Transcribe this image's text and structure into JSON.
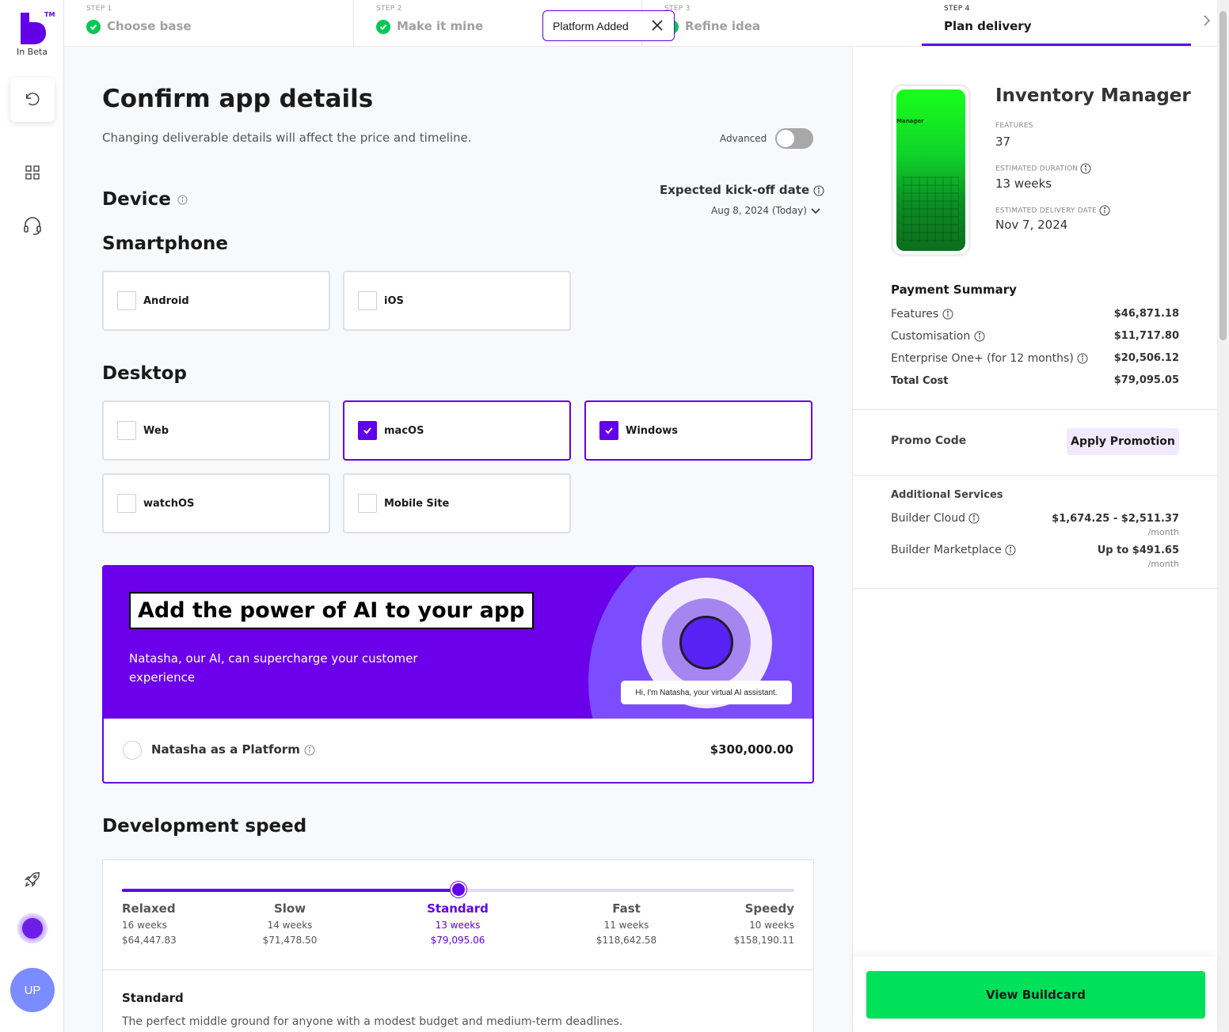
{
  "app": {
    "beta_label": "In Beta",
    "user_initials": "UP",
    "brand_color": "#6200ea",
    "cta_color": "#00e15a"
  },
  "toast": {
    "text": "Platform Added"
  },
  "steps": [
    {
      "num": "STEP 1",
      "label": "Choose base",
      "done": true
    },
    {
      "num": "STEP 2",
      "label": "Make it mine",
      "done": true
    },
    {
      "num": "STEP 3",
      "label": "Refine idea",
      "done": true
    },
    {
      "num": "STEP 4",
      "label": "Plan delivery",
      "done": false,
      "active": true
    }
  ],
  "main": {
    "title": "Confirm app details",
    "subtitle": "Changing deliverable details will affect the price and timeline.",
    "advanced_label": "Advanced",
    "advanced_on": false,
    "device_heading": "Device",
    "kickoff_label": "Expected kick-off date",
    "kickoff_date": "Aug 8, 2024 (Today)",
    "smartphone_heading": "Smartphone",
    "smartphone_options": [
      {
        "label": "Android",
        "checked": false
      },
      {
        "label": "iOS",
        "checked": false
      }
    ],
    "desktop_heading": "Desktop",
    "desktop_options": [
      {
        "label": "Web",
        "checked": false
      },
      {
        "label": "macOS",
        "checked": true
      },
      {
        "label": "Windows",
        "checked": true
      },
      {
        "label": "watchOS",
        "checked": false
      },
      {
        "label": "Mobile Site",
        "checked": false
      }
    ],
    "ai": {
      "title": "Add the power of AI to your app",
      "description": "Natasha, our AI, can supercharge your customer experience",
      "bubble": "Hi, I'm Natasha, your virtual AI assistant.",
      "option_label": "Natasha as a Platform",
      "option_price": "$300,000.00",
      "selected": false
    },
    "speed_heading": "Development speed",
    "speed_selected_index": 2,
    "speeds": [
      {
        "name": "Relaxed",
        "weeks": "16 weeks",
        "price": "$64,447.83"
      },
      {
        "name": "Slow",
        "weeks": "14 weeks",
        "price": "$71,478.50"
      },
      {
        "name": "Standard",
        "weeks": "13 weeks",
        "price": "$79,095.06"
      },
      {
        "name": "Fast",
        "weeks": "11 weeks",
        "price": "$118,642.58"
      },
      {
        "name": "Speedy",
        "weeks": "10 weeks",
        "price": "$158,190.11"
      }
    ],
    "speed_detail_name": "Standard",
    "speed_detail_desc": "The perfect middle ground for anyone with a modest budget and medium-term deadlines."
  },
  "panel": {
    "phone_text": "Manager",
    "app_name": "Inventory Manager",
    "features_label": "FEATURES",
    "features_value": "37",
    "duration_label": "ESTIMATED DURATION",
    "duration_value": "13 weeks",
    "delivery_label": "ESTIMATED DELIVERY DATE",
    "delivery_value": "Nov 7, 2024",
    "payment_title": "Payment Summary",
    "payment_rows": [
      {
        "label": "Features",
        "value": "$46,871.18"
      },
      {
        "label": "Customisation",
        "value": "$11,717.80"
      },
      {
        "label": "Enterprise One+ (for 12 months)",
        "value": "$20,506.12"
      },
      {
        "label": "Total Cost",
        "value": "$79,095.05"
      }
    ],
    "promo_label": "Promo Code",
    "promo_button": "Apply Promotion",
    "additional_title": "Additional Services",
    "services": [
      {
        "label": "Builder Cloud",
        "value": "$1,674.25 - $2,511.37",
        "unit": "/month"
      },
      {
        "label": "Builder Marketplace",
        "value": "Up to $491.65",
        "unit": "/month"
      }
    ],
    "cta": "View Buildcard"
  }
}
